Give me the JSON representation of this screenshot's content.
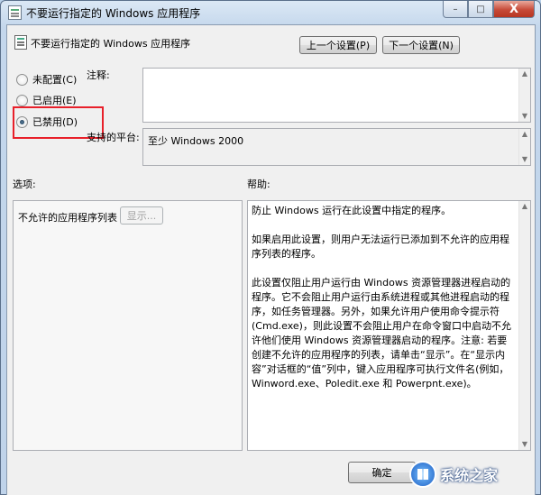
{
  "window": {
    "title": "不要运行指定的 Windows 应用程序",
    "buttons": {
      "minimize": "–",
      "maximize": "□",
      "close": "X"
    }
  },
  "policy": {
    "heading": "不要运行指定的 Windows 应用程序",
    "prev_label": "上一个设置(P)",
    "next_label": "下一个设置(N)"
  },
  "state": {
    "options": [
      {
        "label": "未配置(C)",
        "checked": false
      },
      {
        "label": "已启用(E)",
        "checked": false
      },
      {
        "label": "已禁用(D)",
        "checked": true
      }
    ]
  },
  "comment": {
    "label": "注释:",
    "value": ""
  },
  "platform": {
    "label": "支持的平台:",
    "value": "至少 Windows 2000"
  },
  "options_panel": {
    "label": "选项:",
    "item_label": "不允许的应用程序列表",
    "show_button": "显示..."
  },
  "help_panel": {
    "label": "帮助:",
    "text": "防止 Windows 运行在此设置中指定的程序。\n\n如果启用此设置，则用户无法运行已添加到不允许的应用程序列表的程序。\n\n此设置仅阻止用户运行由 Windows 资源管理器进程启动的程序。它不会阻止用户运行由系统进程或其他进程启动的程序，如任务管理器。另外，如果允许用户使用命令提示符(Cmd.exe)，则此设置不会阻止用户在命令窗口中启动不允许他们使用 Windows 资源管理器启动的程序。注意: 若要创建不允许的应用程序的列表，请单击“显示”。在“显示内容”对话框的“值”列中，键入应用程序可执行文件名(例如，Winword.exe、Poledit.exe 和 Powerpnt.exe)。"
  },
  "footer": {
    "ok_label": "确定"
  },
  "watermark": {
    "text": "系统之家"
  },
  "colors": {
    "highlight": "#e8202a"
  }
}
